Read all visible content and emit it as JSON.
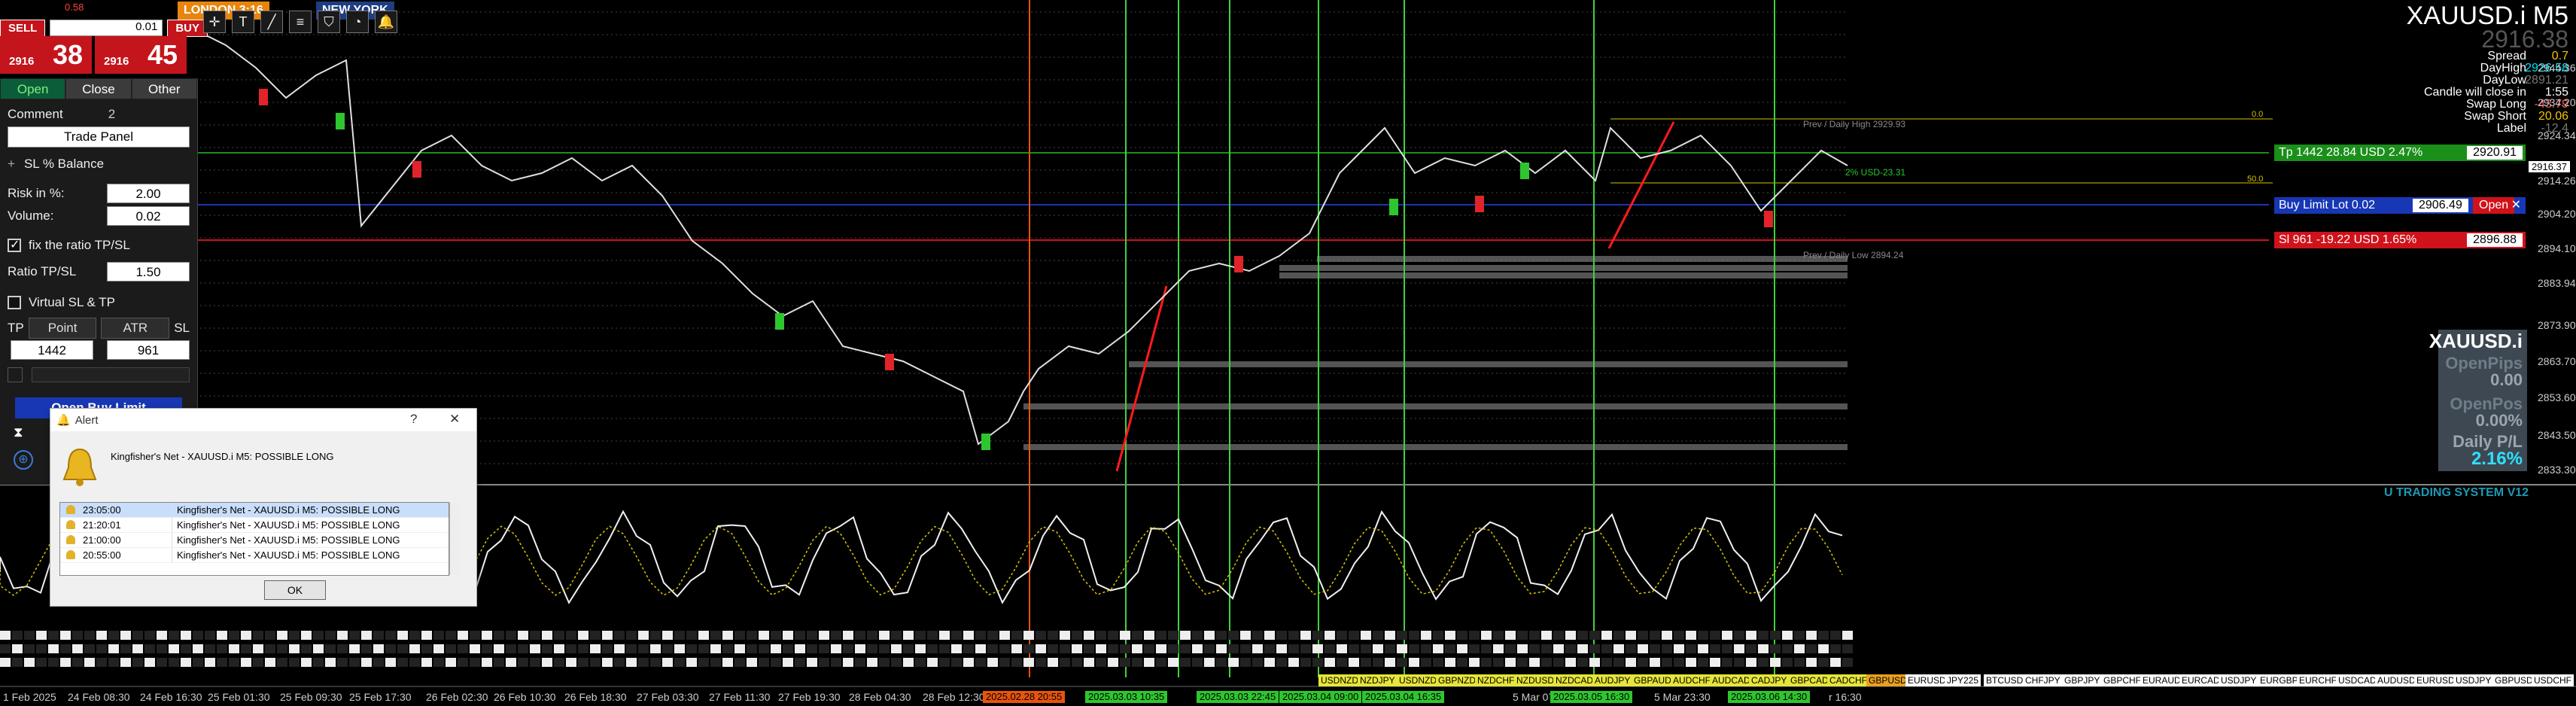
{
  "window": {
    "symbol_title": "XAUUSD.i M5",
    "current_price": "2916.38"
  },
  "one_click": {
    "sell_label": "SELL",
    "buy_label": "BUY",
    "lot": "0.01",
    "daily_change_text": "0.58"
  },
  "session_tags": [
    {
      "label": "LONDON 3:16",
      "bg": "#e8850c"
    },
    {
      "label": "NEW YORK",
      "bg": "#1e3d82"
    }
  ],
  "price_boxes": {
    "sell": {
      "small": "2916",
      "big": "38"
    },
    "buy": {
      "small": "2916",
      "big": "45"
    }
  },
  "toolbar_icons": [
    "crosshair-icon",
    "text-icon",
    "trendline-icon",
    "fibonacci-icon",
    "shield-icon",
    "pie-icon",
    "alert-bell-icon"
  ],
  "trade_panel": {
    "tabs": [
      "Open",
      "Close",
      "Other"
    ],
    "comment_label": "Comment",
    "comment_value": "2",
    "trade_panel_button": "Trade Panel",
    "sl_balance_label": "SL % Balance",
    "risk_label": "Risk in %:",
    "risk_value": "2.00",
    "volume_label": "Volume:",
    "volume_value": "0.02",
    "fix_ratio_label": "fix the ratio TP/SL",
    "ratio_label": "Ratio TP/SL",
    "ratio_value": "1.50",
    "virtual_label": "Virtual SL & TP",
    "tp_label": "TP",
    "point_label": "Point",
    "atr_label": "ATR",
    "sl_label": "SL",
    "tp_value": "1442",
    "sl_value": "961",
    "open_limit_label": "Open Buy Limit"
  },
  "alert": {
    "title": "Alert",
    "message": "Kingfisher's Net - XAUUSD.i M5: POSSIBLE LONG",
    "rows": [
      {
        "time": "23:05:00",
        "text": "Kingfisher's Net - XAUUSD.i M5: POSSIBLE LONG"
      },
      {
        "time": "21:20:01",
        "text": "Kingfisher's Net - XAUUSD.i M5: POSSIBLE LONG"
      },
      {
        "time": "21:00:00",
        "text": "Kingfisher's Net - XAUUSD.i M5: POSSIBLE LONG"
      },
      {
        "time": "20:55:00",
        "text": "Kingfisher's Net - XAUUSD.i M5: POSSIBLE LONG"
      }
    ],
    "ok_label": "OK"
  },
  "symbol_info": [
    {
      "label": "Spread",
      "value": "0.7",
      "color": "#f5c400"
    },
    {
      "label": "DayHigh",
      "value": "2926.58",
      "color": "#00e5ff"
    },
    {
      "label": "DayLow",
      "value": "2891.21",
      "color": "#777777"
    },
    {
      "label": "Candle will close in",
      "value": "1:55",
      "color": "#ffffff"
    },
    {
      "label": "Swap Long",
      "value": "-43.79",
      "color": "#ff5a5a"
    },
    {
      "label": "Swap Short",
      "value": "20.06",
      "color": "#f5c400"
    },
    {
      "label": "Label",
      "value": "-12.4",
      "color": "#777777"
    }
  ],
  "orders": {
    "tp": {
      "text": "Tp  1442  28.84 USD  2.47%",
      "price": "2920.91",
      "color": "#1a8f1a"
    },
    "buy_limit": {
      "text": "Buy Limit  Lot 0.02",
      "price": "2906.49",
      "action": "Open",
      "color": "#1737b5"
    },
    "sl": {
      "text": "Sl  961  -19.22 USD  1.65%",
      "price": "2896.88",
      "color": "#d0121b"
    }
  },
  "chart_labels": {
    "prev_high": "Prev / Daily High 2929.93",
    "prev_low": "Prev / Daily Low 2894.24",
    "fib_0": "0.0",
    "fib_50": "50.0",
    "usd_label": "2% USD-23.31",
    "indicator_title": "U TRADING SYSTEM V12"
  },
  "open_pips_panel": {
    "symbol": "XAUUSD.i",
    "open_pips_label": "OpenPips",
    "open_pips_value": "0.00",
    "open_pos_label": "OpenPos",
    "open_pos_value": "0.00%",
    "daily_pl_label": "Daily P/L",
    "daily_pl_value": "2.16%"
  },
  "price_axis": [
    "2944.36",
    "2934.20",
    "2924.34",
    "2914.26",
    "2904.20",
    "2894.10",
    "2883.94",
    "2873.90",
    "2863.70",
    "2853.60",
    "2843.50",
    "2833.30"
  ],
  "current_price_tag": "2916.37",
  "time_axis": [
    "1 Feb 2025",
    "24 Feb 08:30",
    "24 Feb 16:30",
    "25 Feb 01:30",
    "25 Feb 09:30",
    "25 Feb 17:30",
    "26 Feb 02:30",
    "26 Feb 10:30",
    "26 Feb 18:30",
    "27 Feb 03:30",
    "27 Feb 11:30",
    "27 Feb 19:30",
    "28 Feb 04:30",
    "28 Feb 12:30",
    "5 Mar 07:",
    "5 Mar 23:30",
    "r 16:30"
  ],
  "time_tags": [
    {
      "label": "2025.02.28 20:55",
      "color": "#e8540c"
    },
    {
      "label": "2025.03.03 10:35",
      "color": "#2ec62e"
    },
    {
      "label": "2025.03.03 22:45",
      "color": "#2ec62e"
    },
    {
      "label": "2025.03.04 09:00",
      "color": "#2ec62e"
    },
    {
      "label": "2025.03.04 16:35",
      "color": "#2ec62e"
    },
    {
      "label": "2025.03.05 16:30",
      "color": "#2ec62e"
    },
    {
      "label": "2025.03.06 14:30",
      "color": "#2ec62e"
    }
  ],
  "pair_tags": [
    "USDNZD",
    "NZDJPY",
    "USDNZD",
    "GBPNZD",
    "NZDCHF",
    "NZDUSD",
    "NZDCAD",
    "AUDJPY",
    "GBPAUD",
    "AUDCHF",
    "AUDCAD",
    "CADJPY",
    "GBPCAD",
    "CADCHF",
    "GBPUSD",
    "EURUSD",
    "JPY225",
    "BTCUSD",
    "CHFJPY",
    "GBPJPY",
    "GBPCHF",
    "EURAUD",
    "EURCAD",
    "USDJPY",
    "EURGBP",
    "EURCHF",
    "USDCAD",
    "AUDUSD",
    "EURUSD",
    "USDJPY",
    "GBPUSD",
    "USDCHF"
  ],
  "vlines": {
    "orange_x_frac": 0.4,
    "green": [
      0.437,
      0.457,
      0.481,
      0.512,
      0.545,
      0.619,
      0.689
    ]
  }
}
